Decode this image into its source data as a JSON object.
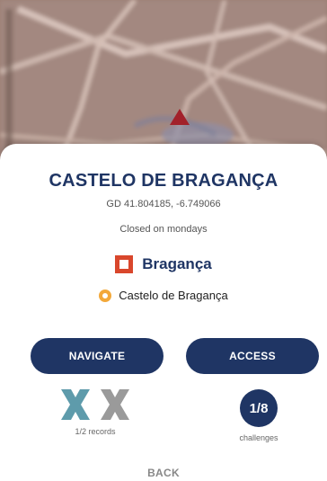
{
  "place": {
    "name": "CASTELO DE BRAGANÇA",
    "coordinates": "GD 41.804185, -6.749066",
    "hours": "Closed on mondays",
    "region": "Bragança",
    "location": "Castelo de Bragança"
  },
  "actions": {
    "navigate_label": "NAVIGATE",
    "access_label": "ACCESS",
    "back_label": "BACK"
  },
  "records": {
    "label": "1/2 records",
    "icons": [
      "record-x-teal-icon",
      "record-x-gray-icon"
    ]
  },
  "challenges": {
    "count": "1/8",
    "label": "challenges"
  },
  "colors": {
    "primary": "#1f3564",
    "region_accent": "#d9472c",
    "location_accent": "#f3a83a",
    "record_teal": "#5e9bab",
    "record_gray": "#9a9a9a"
  }
}
